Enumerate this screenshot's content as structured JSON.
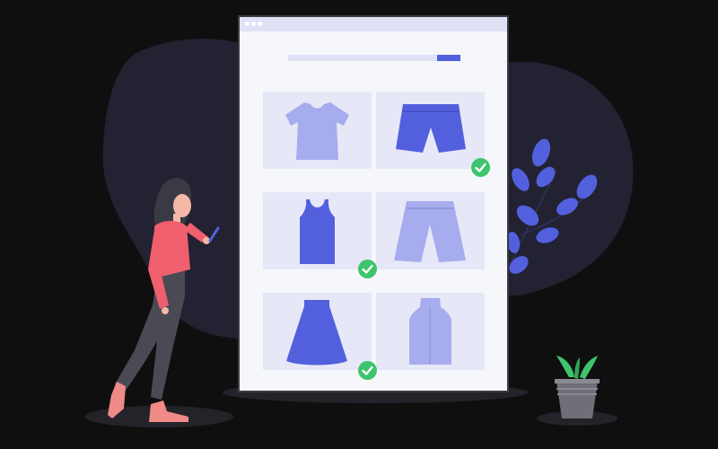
{
  "colors": {
    "background": "#0f0f10",
    "blob": "#222232",
    "accent": "#5360de",
    "light_accent": "#a7acee",
    "card": "#f6f7fb",
    "tile": "#e6e8f7",
    "check": "#3ec46d",
    "jacket": "#ef5f6d",
    "plant": "#3ec46d"
  },
  "search": {
    "progress": 0.14
  },
  "products": [
    {
      "icon": "tshirt-icon",
      "selected": false
    },
    {
      "icon": "shorts-icon",
      "selected": true
    },
    {
      "icon": "tank-top-icon",
      "selected": true
    },
    {
      "icon": "long-shorts-icon",
      "selected": false
    },
    {
      "icon": "skirt-icon",
      "selected": true
    },
    {
      "icon": "vest-icon",
      "selected": false
    }
  ],
  "decor": [
    "woman-with-phone-illustration",
    "leaf-branch-icon",
    "potted-plant-icon"
  ]
}
